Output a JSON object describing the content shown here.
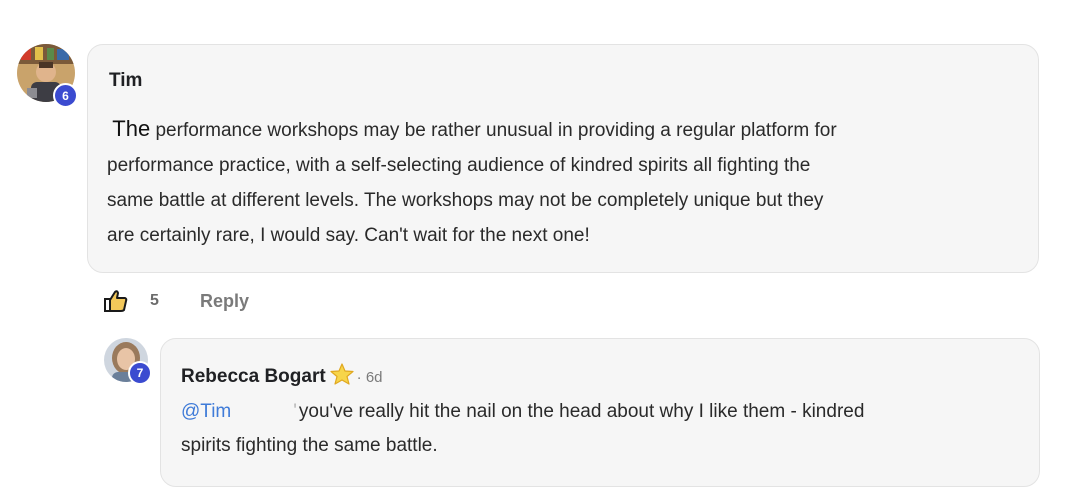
{
  "comment": {
    "author": "Tim",
    "level": "6",
    "lead_word": "The",
    "line1": "performance workshops may be rather unusual in providing a regular platform for",
    "line2": "performance practice, with a self-selecting audience of kindred spirits all fighting the",
    "line3": "same battle at different levels. The workshops may not be completely unique but they",
    "line4": "are certainly rare, I would say. Can't wait for the next one!",
    "likes": "5",
    "reply_label": "Reply"
  },
  "reply": {
    "author": "Rebecca Bogart",
    "level": "7",
    "meta": "· 6d",
    "mention": "@Tim",
    "line1_rest": "you've really hit the nail on the head about why I like them - kindred",
    "line2": "spirits fighting the same battle."
  },
  "icons": {
    "like": "thumbs-up-icon",
    "star": "star-icon"
  },
  "colors": {
    "badge": "#3b4bd0",
    "mention": "#3f7bd8",
    "bubble": "#f6f6f6"
  }
}
